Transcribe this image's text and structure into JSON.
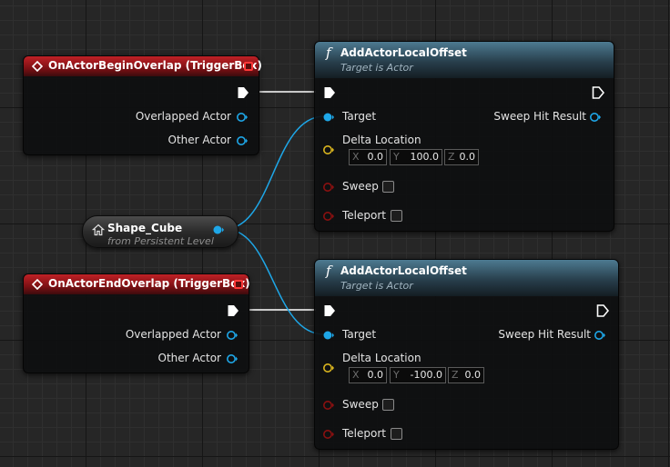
{
  "colors": {
    "exec_wire": "#ffffff",
    "object_wire": "#1ea7e8",
    "vector_pin": "#d9b41f",
    "bool_pin": "#8a1010",
    "event_header": "#a0191e",
    "function_header": "#3e6378"
  },
  "events": [
    {
      "title": "OnActorBeginOverlap (TriggerBox)",
      "pins": [
        "Overlapped Actor",
        "Other Actor"
      ]
    },
    {
      "title": "OnActorEndOverlap (TriggerBox)",
      "pins": [
        "Overlapped Actor",
        "Other Actor"
      ]
    }
  ],
  "functions": [
    {
      "icon": "f",
      "title": "AddActorLocalOffset",
      "subtitle": "Target is Actor",
      "target_label": "Target",
      "delta_label": "Delta Location",
      "delta": {
        "x": "0.0",
        "y": "100.0",
        "z": "0.0"
      },
      "sweep_label": "Sweep",
      "teleport_label": "Teleport",
      "hit_label": "Sweep Hit Result",
      "sweep_checked": false,
      "teleport_checked": false
    },
    {
      "icon": "f",
      "title": "AddActorLocalOffset",
      "subtitle": "Target is Actor",
      "target_label": "Target",
      "delta_label": "Delta Location",
      "delta": {
        "x": "0.0",
        "y": "-100.0",
        "z": "0.0"
      },
      "sweep_label": "Sweep",
      "teleport_label": "Teleport",
      "hit_label": "Sweep Hit Result",
      "sweep_checked": false,
      "teleport_checked": false
    }
  ],
  "getter": {
    "title": "Shape_Cube",
    "subtitle": "from Persistent Level"
  },
  "axis_labels": {
    "x": "X",
    "y": "Y",
    "z": "Z"
  }
}
